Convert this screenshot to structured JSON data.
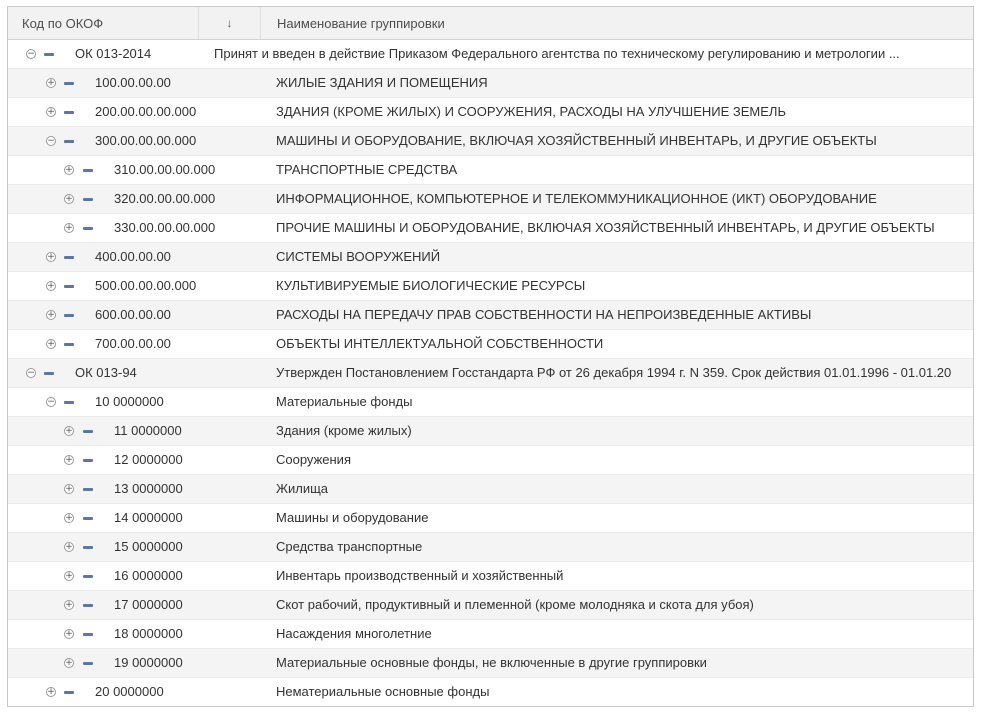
{
  "header": {
    "code_label": "Код по ОКОФ",
    "sort_icon": "↓",
    "name_label": "Наименование группировки"
  },
  "rows": [
    {
      "level": 0,
      "state": "expanded",
      "code": "ОК 013-2014",
      "name": "Принят и введен в действие Приказом Федерального агентства по техническому регулированию и метрологии ..."
    },
    {
      "level": 1,
      "state": "collapsed",
      "code": "100.00.00.00",
      "name": "ЖИЛЫЕ ЗДАНИЯ И ПОМЕЩЕНИЯ"
    },
    {
      "level": 1,
      "state": "collapsed",
      "code": "200.00.00.00.000",
      "name": "ЗДАНИЯ (КРОМЕ ЖИЛЫХ) И СООРУЖЕНИЯ, РАСХОДЫ НА УЛУЧШЕНИЕ ЗЕМЕЛЬ"
    },
    {
      "level": 1,
      "state": "expanded",
      "code": "300.00.00.00.000",
      "name": "МАШИНЫ И ОБОРУДОВАНИЕ, ВКЛЮЧАЯ ХОЗЯЙСТВЕННЫЙ ИНВЕНТАРЬ, И ДРУГИЕ ОБЪЕКТЫ"
    },
    {
      "level": 2,
      "state": "collapsed",
      "code": "310.00.00.00.000",
      "name": "ТРАНСПОРТНЫЕ СРЕДСТВА"
    },
    {
      "level": 2,
      "state": "collapsed",
      "code": "320.00.00.00.000",
      "name": "ИНФОРМАЦИОННОЕ, КОМПЬЮТЕРНОЕ И ТЕЛЕКОММУНИКАЦИОННОЕ (ИКТ) ОБОРУДОВАНИЕ"
    },
    {
      "level": 2,
      "state": "collapsed",
      "code": "330.00.00.00.000",
      "name": "ПРОЧИЕ МАШИНЫ И ОБОРУДОВАНИЕ, ВКЛЮЧАЯ ХОЗЯЙСТВЕННЫЙ ИНВЕНТАРЬ, И ДРУГИЕ ОБЪЕКТЫ"
    },
    {
      "level": 1,
      "state": "collapsed",
      "code": "400.00.00.00",
      "name": "СИСТЕМЫ ВООРУЖЕНИЙ"
    },
    {
      "level": 1,
      "state": "collapsed",
      "code": "500.00.00.00.000",
      "name": "КУЛЬТИВИРУЕМЫЕ БИОЛОГИЧЕСКИЕ РЕСУРСЫ"
    },
    {
      "level": 1,
      "state": "collapsed",
      "code": "600.00.00.00",
      "name": "РАСХОДЫ НА ПЕРЕДАЧУ ПРАВ СОБСТВЕННОСТИ НА НЕПРОИЗВЕДЕННЫЕ АКТИВЫ"
    },
    {
      "level": 1,
      "state": "collapsed",
      "code": "700.00.00.00",
      "name": "ОБЪЕКТЫ ИНТЕЛЛЕКТУАЛЬНОЙ СОБСТВЕННОСТИ"
    },
    {
      "level": 0,
      "state": "expanded",
      "code": "ОК 013-94",
      "name": "Утвержден Постановлением Госстандарта РФ от 26 декабря 1994 г. N 359.  Срок действия 01.01.1996 - 01.01.20"
    },
    {
      "level": 1,
      "state": "expanded",
      "code": "10 0000000",
      "name": "Материальные фонды"
    },
    {
      "level": 2,
      "state": "collapsed",
      "code": "11 0000000",
      "name": "Здания (кроме жилых)"
    },
    {
      "level": 2,
      "state": "collapsed",
      "code": "12 0000000",
      "name": "Сооружения"
    },
    {
      "level": 2,
      "state": "collapsed",
      "code": "13 0000000",
      "name": "Жилища"
    },
    {
      "level": 2,
      "state": "collapsed",
      "code": "14 0000000",
      "name": "Машины и оборудование"
    },
    {
      "level": 2,
      "state": "collapsed",
      "code": "15 0000000",
      "name": "Средства транспортные"
    },
    {
      "level": 2,
      "state": "collapsed",
      "code": "16 0000000",
      "name": "Инвентарь производственный и хозяйственный"
    },
    {
      "level": 2,
      "state": "collapsed",
      "code": "17 0000000",
      "name": "Скот рабочий, продуктивный и племенной (кроме молодняка и скота для убоя)"
    },
    {
      "level": 2,
      "state": "collapsed",
      "code": "18 0000000",
      "name": "Насаждения многолетние"
    },
    {
      "level": 2,
      "state": "collapsed",
      "code": "19 0000000",
      "name": "Материальные основные фонды, не включенные в другие группировки"
    },
    {
      "level": 1,
      "state": "collapsed",
      "code": "20 0000000",
      "name": "Нематериальные основные фонды"
    }
  ],
  "icons": {
    "expanded": "⊖",
    "collapsed": "⊕",
    "group": "group-icon"
  },
  "colors": {
    "group_icon": "#5d76a6",
    "alt_row": "#f4f4f4",
    "header_bg": "#f2f2f2"
  }
}
